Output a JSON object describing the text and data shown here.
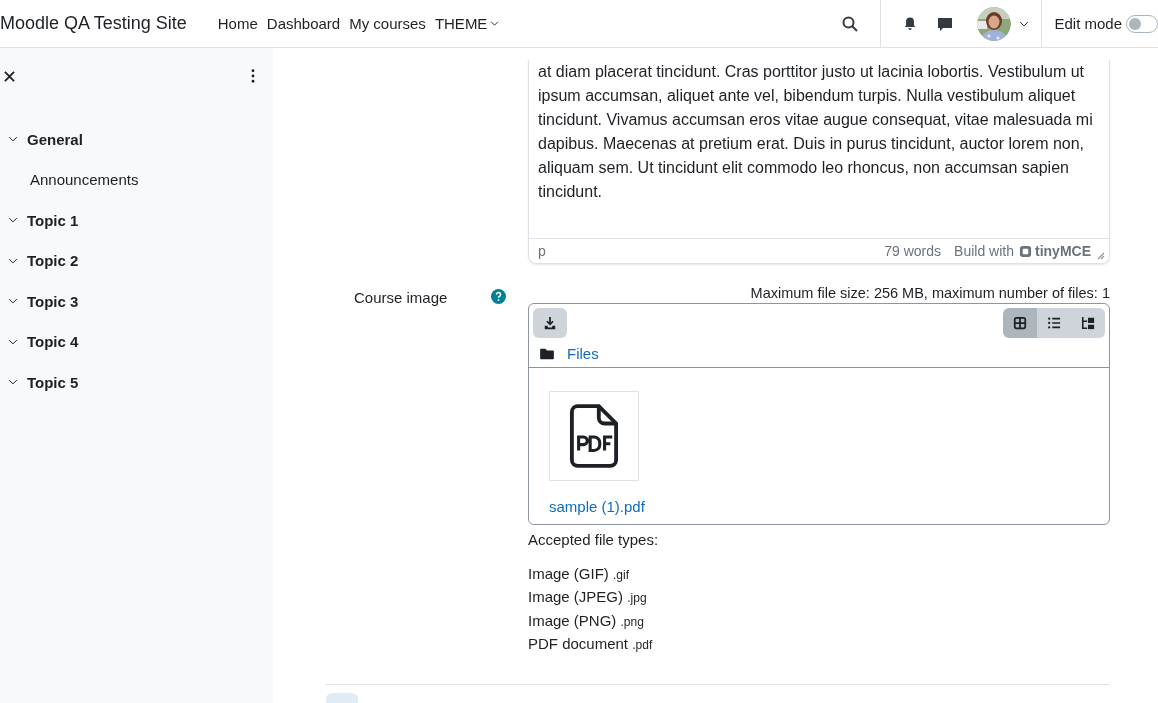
{
  "navbar": {
    "site_name": "Moodle QA Testing Site",
    "links": [
      {
        "label": "Home",
        "kind": "link"
      },
      {
        "label": "Dashboard",
        "kind": "link"
      },
      {
        "label": "My courses",
        "kind": "link"
      },
      {
        "label": "THEME",
        "kind": "dropdown"
      }
    ],
    "edit_mode": {
      "label": "Edit mode",
      "on": false
    }
  },
  "course_index": {
    "sections": [
      {
        "title": "General",
        "expanded": true,
        "children": [
          {
            "title": "Announcements"
          }
        ]
      },
      {
        "title": "Topic 1",
        "expanded": true
      },
      {
        "title": "Topic 2",
        "expanded": true
      },
      {
        "title": "Topic 3",
        "expanded": true
      },
      {
        "title": "Topic 4",
        "expanded": true
      },
      {
        "title": "Topic 5",
        "expanded": true
      }
    ]
  },
  "editor": {
    "text": "at diam placerat tincidunt. Cras porttitor justo ut lacinia lobortis. Vestibulum ut ipsum accumsan, aliquet ante vel, bibendum turpis. Nulla vestibulum aliquet tincidunt. Vivamus accumsan eros vitae augue consequat, vitae malesuada mi dapibus. Maecenas at pretium erat. Duis in purus tincidunt, auctor lorem non, aliquam sem. Ut tincidunt elit commodo leo rhoncus, non accumsan sapien tincidunt.",
    "path": "p",
    "word_count": "79 words",
    "branding": "Build with",
    "logo": "tinyMCE"
  },
  "course_image": {
    "label": "Course image",
    "limits": "Maximum file size: 256 MB, maximum number of files: 1",
    "views": [
      {
        "kind": "icons",
        "selected": true
      },
      {
        "kind": "list",
        "selected": false
      },
      {
        "kind": "tree",
        "selected": false
      }
    ],
    "breadcrumb": "Files",
    "files": [
      {
        "name": "sample (1).pdf",
        "kind": "pdf"
      }
    ],
    "accepted_title": "Accepted file types:",
    "accepted_types": [
      {
        "name": "Image (GIF)",
        "ext": ".gif"
      },
      {
        "name": "Image (JPEG)",
        "ext": ".jpg"
      },
      {
        "name": "Image (PNG)",
        "ext": ".png"
      },
      {
        "name": "PDF document",
        "ext": ".pdf"
      }
    ]
  }
}
